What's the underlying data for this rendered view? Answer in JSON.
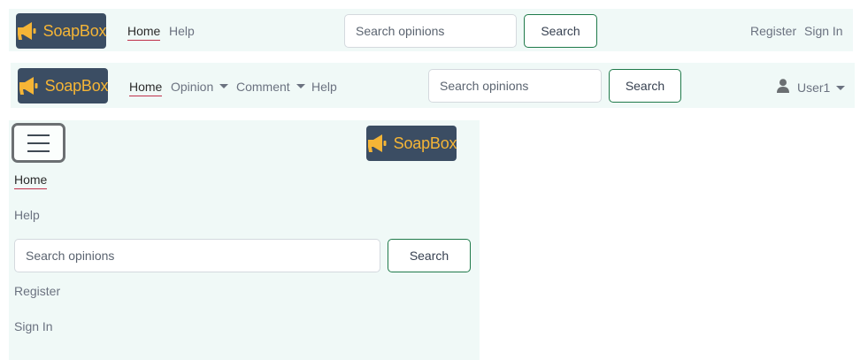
{
  "brand": {
    "name": "SoapBox",
    "logo_icon": "megaphone-icon",
    "color": "#f5b536",
    "background": "#3b4d63"
  },
  "colors": {
    "navbar_bg": "#f0f9f7",
    "button_border": "#1f7a4a",
    "active_underline": "#c0304a"
  },
  "navbar_guest": {
    "links": [
      "Home",
      "Help"
    ],
    "active": "Home",
    "search": {
      "placeholder": "Search opinions",
      "button": "Search"
    },
    "auth": {
      "register": "Register",
      "sign_in": "Sign In"
    }
  },
  "navbar_user": {
    "links": {
      "home": "Home",
      "opinion": "Opinion",
      "comment": "Comment",
      "help": "Help"
    },
    "active": "Home",
    "search": {
      "placeholder": "Search opinions",
      "button": "Search"
    },
    "user": {
      "name": "User1",
      "icon": "user-icon"
    }
  },
  "navbar_mobile": {
    "toggle_icon": "hamburger-icon",
    "links": [
      "Home",
      "Help"
    ],
    "search": {
      "placeholder": "Search opinions",
      "button": "Search"
    },
    "auth": {
      "register": "Register",
      "sign_in": "Sign In"
    }
  }
}
